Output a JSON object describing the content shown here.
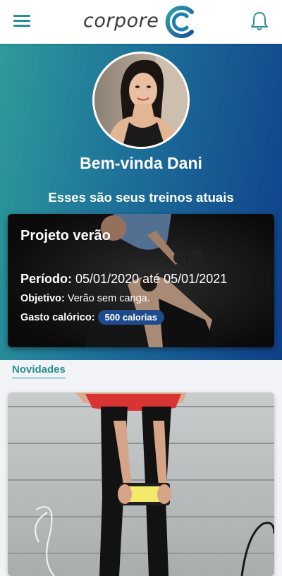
{
  "app": {
    "brand_name": "corpore",
    "accent_color": "#2a8f93",
    "gradient_start": "#2e9b9a",
    "gradient_end": "#0f3f8a"
  },
  "header": {
    "menu_icon": "hamburger-menu-icon",
    "notifications_icon": "bell-icon"
  },
  "profile": {
    "welcome": "Bem-vinda Dani"
  },
  "workouts": {
    "section_title": "Esses são seus treinos atuais",
    "current": {
      "name": "Projeto verão",
      "period_label": "Período:",
      "period_value": "05/01/2020 até 05/01/2021",
      "objective_label": "Objetivo:",
      "objective_value": "Verão sem canga.",
      "calories_label": "Gasto calórico:",
      "calories_value": "500 calorias"
    }
  },
  "news": {
    "title": "Novidades"
  }
}
